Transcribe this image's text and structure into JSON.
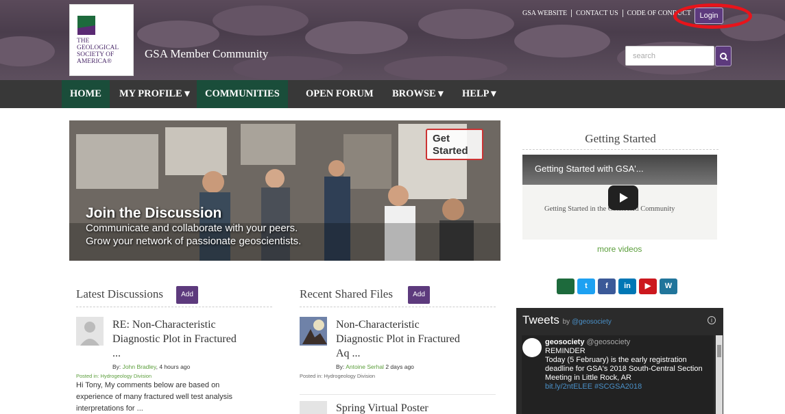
{
  "header": {
    "logo_text": "THE GEOLOGICAL SOCIETY OF AMERICA®",
    "site_title": "GSA Member Community",
    "top_links": [
      "GSA WEBSITE",
      "CONTACT US",
      "CODE OF CONDUCT"
    ],
    "login_label": "Login",
    "search_placeholder": "search",
    "search_icon": "search-icon"
  },
  "nav": {
    "items": [
      {
        "label": "HOME"
      },
      {
        "label": "MY PROFILE ▾"
      },
      {
        "label": "COMMUNITIES"
      },
      {
        "label": "OPEN FORUM"
      },
      {
        "label": "BROWSE ▾"
      },
      {
        "label": "HELP ▾"
      }
    ]
  },
  "hero": {
    "title": "Join the Discussion",
    "subtitle_line1": "Communicate and collaborate with your peers.",
    "subtitle_line2": "Grow your network of passionate geoscientists.",
    "get_started_label": "Get Started"
  },
  "getting_started": {
    "title": "Getting Started",
    "video_title": "Getting Started with GSA'...",
    "video_slide_text": "Getting Started in the Connected Community",
    "more_videos": "more videos"
  },
  "social_icons": [
    "gsa-icon",
    "twitter-icon",
    "facebook-icon",
    "linkedin-icon",
    "youtube-icon",
    "wordpress-icon"
  ],
  "tweets": {
    "title": "Tweets",
    "by": "by",
    "handle_link": "@geosociety",
    "tweet": {
      "name": "geosociety",
      "handle": "@geosociety",
      "line1": "REMINDER",
      "line2": "Today (5 February) is the early registration deadline for GSA's 2018 South-Central Section Meeting in Little Rock, AR",
      "links": "bit.ly/2ntELEE #SCGSA2018"
    }
  },
  "latest_discussions": {
    "heading": "Latest Discussions",
    "add_label": "Add",
    "post": {
      "title_line1": "RE: Non-Characteristic",
      "title_line2": "Diagnostic Plot in Fractured",
      "title_line3": "...",
      "by": "By:",
      "author": "John Bradley",
      "time": ", 4 hours ago",
      "posted_in_label": "Posted in:",
      "posted_in": "Hydrogeology Division",
      "excerpt_line1": "Hi Tony, My comments below are based on",
      "excerpt_line2": "experience of many fractured well test analysis",
      "excerpt_line3": "interpretations for ..."
    }
  },
  "recent_files": {
    "heading": "Recent Shared Files",
    "add_label": "Add",
    "file1": {
      "title_line1": "Non-Characteristic",
      "title_line2": "Diagnostic Plot in Fractured",
      "title_line3": "Aq ...",
      "by": "By:",
      "author": "Antoine Serhal",
      "time": " 2 days ago",
      "posted_in_label": "Posted in:",
      "posted_in": "Hydrogeology Division"
    },
    "file2": {
      "title": "Spring Virtual Poster"
    }
  }
}
